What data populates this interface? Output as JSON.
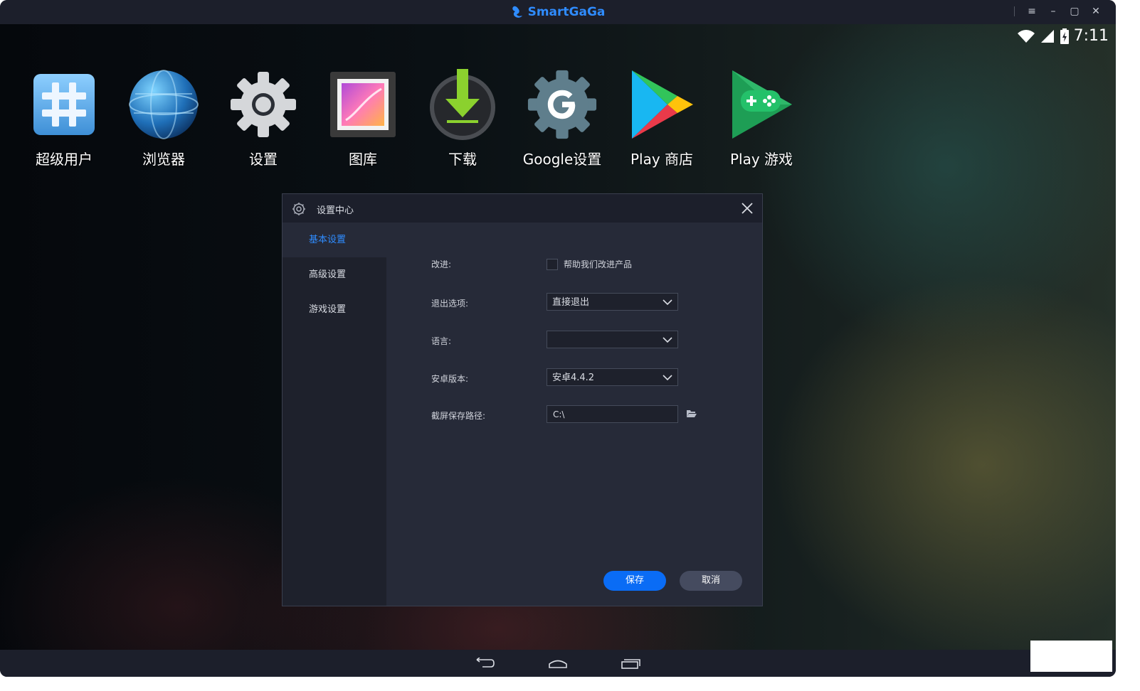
{
  "window": {
    "title": "SmartGaGa",
    "controls": {
      "menu": "≡",
      "minimize": "–",
      "maximize": "▢",
      "close": "✕"
    }
  },
  "status": {
    "time": "7:11"
  },
  "apps": [
    {
      "label": "超级用户",
      "icon": "superuser-icon"
    },
    {
      "label": "浏览器",
      "icon": "globe-icon"
    },
    {
      "label": "设置",
      "icon": "gear-icon"
    },
    {
      "label": "图库",
      "icon": "gallery-icon"
    },
    {
      "label": "下载",
      "icon": "download-icon"
    },
    {
      "label": "Google设置",
      "icon": "google-settings-icon"
    },
    {
      "label": "Play 商店",
      "icon": "play-store-icon"
    },
    {
      "label": "Play 游戏",
      "icon": "play-games-icon"
    }
  ],
  "dialog": {
    "title": "设置中心",
    "sidebar": [
      {
        "label": "基本设置",
        "active": true
      },
      {
        "label": "高级设置",
        "active": false
      },
      {
        "label": "游戏设置",
        "active": false
      }
    ],
    "form": {
      "improve_label": "改进:",
      "improve_checkbox_label": "帮助我们改进产品",
      "exit_label": "退出选项:",
      "exit_value": "直接退出",
      "language_label": "语言:",
      "language_value": "",
      "android_label": "安卓版本:",
      "android_value": "安卓4.4.2",
      "screenshot_label": "截屏保存路径:",
      "screenshot_value": "C:\\"
    },
    "buttons": {
      "save": "保存",
      "cancel": "取消"
    }
  },
  "colors": {
    "accent": "#2f8cff",
    "save_button": "#0a6cf5",
    "cancel_button": "#454b5f"
  }
}
